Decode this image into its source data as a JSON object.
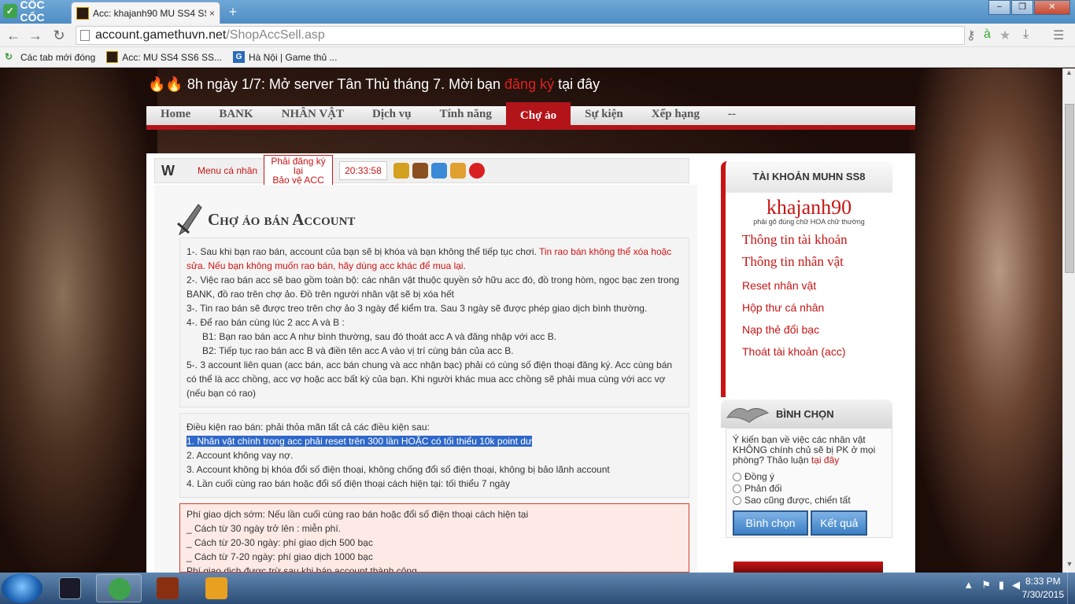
{
  "browser": {
    "brand": "CỐC CỐC",
    "tab_title": "Acc: khajanh90 MU SS4 SS",
    "tab_close": "×",
    "new_tab": "+",
    "win_min": "−",
    "win_max": "❐",
    "win_close": "✕",
    "back": "←",
    "forward": "→",
    "reload": "↻",
    "url_host": "account.gamethuvn.net",
    "url_path": "/ShopAccSell.asp",
    "bookmarks": [
      {
        "label": "Các tab mới đóng"
      },
      {
        "label": "Acc: MU SS4 SS6 SS..."
      },
      {
        "label": "Hà Nội | Game thủ ..."
      }
    ]
  },
  "site": {
    "announce_prefix": "8h ngày 1/7: Mở server Tân Thủ tháng 7. Mời bạn",
    "announce_link": "đăng ký",
    "announce_suffix": "tại đây",
    "menu": [
      "Home",
      "BANK",
      "NHÂN VẬT",
      "Dịch vụ",
      "Tính năng",
      "Chợ ảo",
      "Sự kiện",
      "Xếp hạng",
      "--"
    ],
    "active_menu": "Chợ ảo"
  },
  "userbar": {
    "logo": "W",
    "menu_link": "Menu cá nhân",
    "warn_line1": "Phải đăng ký lại",
    "warn_line2": "Bảo vệ ACC",
    "time": "20:33:58"
  },
  "main": {
    "title": "Chợ ảo bán Account",
    "rules": {
      "r1_a": "1-. Sau khi bạn rao bán, account của bạn sẽ bị khóa và bạn không thể tiếp tục chơi.",
      "r1_b": "Tin rao bán không thể xóa hoặc sửa. Nếu bạn không muốn rao bán, hãy dùng acc khác để mua lại.",
      "r2": "2-. Việc rao bán acc sẽ bao gồm toàn bộ: các nhân vật thuộc quyền sở hữu acc đó, đồ trong hòm, ngọc bạc zen trong BANK, đồ rao trên chợ ảo. Đồ trên người nhân vật sẽ bị xóa hết",
      "r3": "3-. Tin rao bán sẽ được treo trên chợ ảo 3 ngày để kiểm tra. Sau 3 ngày sẽ được phép giao dịch bình thường.",
      "r4": "4-. Để rao bán cùng lúc 2 acc A và B :",
      "r4_b1": "B1: Bạn rao bán acc A như bình thường, sau đó thoát acc A và đăng nhập với acc B.",
      "r4_b2": "B2: Tiếp tục rao bán acc B và điền tên acc A vào vị trí cùng bán của acc B.",
      "r5": "5-. 3 account liên quan (acc bán, acc bán chung và acc nhận bạc) phải có cùng số điện thoại đăng ký. Acc cùng bán có thể là acc chồng, acc vợ hoặc acc bất kỳ của bạn. Khi người khác mua acc chồng sẽ phải mua cùng với acc vợ (nếu bạn có rao)"
    },
    "conditions": {
      "head": "Điều kiện rao bán: phải thỏa mãn tất cả các điều kiện sau:",
      "c1": "1. Nhân vật chính trong acc phải reset trên 300 lần HOẶC có tối thiểu 10k point dư",
      "c2": "2. Account không vay nợ.",
      "c3": "3. Account không bị khóa đổi số điện thoại, không chống đổi số điện thoại, không bị bảo lãnh account",
      "c4": "4. Lần cuối cùng rao bán hoặc đổi số điện thoại cách hiện tại: tối thiểu 7 ngày"
    },
    "fees": {
      "head": "Phí giao dịch sớm: Nếu lần cuối cùng rao bán hoặc đổi số điện thoại cách hiện tại",
      "f1": "_ Cách từ 30 ngày trở lên : miễn phí.",
      "f2": "_ Cách từ 20-30 ngày: phí giao dịch 500 bạc",
      "f3": "_ Cách từ 7-20 ngày: phí giao dịch 1000 bạc",
      "f4": "Phí giao dịch được trừ sau khi bán account thành công"
    }
  },
  "sidebar": {
    "acc_title": "TÀI KHOẢN MUHN SS8",
    "username": "khajanh90",
    "hint": "phải gõ đúng chữ HOA chữ thường",
    "links_big": [
      "Thông tin tài khoản",
      "Thông tin nhân vật"
    ],
    "links_small": [
      "Reset nhân vật",
      "Hộp thư cá nhân",
      "Nạp thẻ đổi bạc",
      "Thoát tài khoản (acc)"
    ],
    "poll_title": "BÌNH CHỌN",
    "poll_question": "Ý kiến bạn về việc các nhân vật KHÔNG chính chủ sẽ bị PK ở mọi phòng? Thảo luận",
    "poll_link": "tại đây",
    "poll_options": [
      "Đồng ý",
      "Phản đối",
      "Sao cũng được, chiến tất"
    ],
    "vote_btn": "Bình chọn",
    "result_btn": "Kết quả"
  },
  "taskbar": {
    "time": "8:33 PM",
    "date": "7/30/2015"
  },
  "colors": {
    "accent_red": "#c81414",
    "menu_red": "#b3141a",
    "highlight_blue": "#2f68c8",
    "button_blue": "#3c7fc4"
  }
}
